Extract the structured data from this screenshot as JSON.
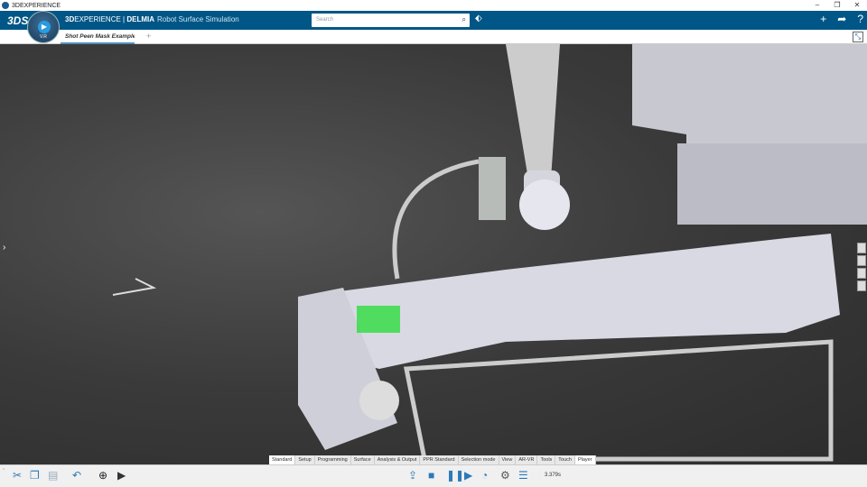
{
  "window": {
    "title": "3DEXPERIENCE",
    "controls": [
      "–",
      "❐",
      "✕"
    ]
  },
  "header": {
    "brand": "3DEXPERIENCE",
    "brand_bold": "3D",
    "brand_rest": "EXPERIENCE",
    "separator": " | ",
    "app": "DELMIA",
    "app_sub": "Robot Surface Simulation",
    "compass_version": "V.R",
    "search_placeholder": "Search"
  },
  "tabs": [
    {
      "label": "Shot Peen Mask Example A"
    }
  ],
  "toolbar_tabs": [
    "Standard",
    "Setup",
    "Programming",
    "Surface",
    "Analysis & Output",
    "PPR Standard",
    "Selection mode",
    "View",
    "AR-VR",
    "Tools",
    "Touch",
    "Player"
  ],
  "active_toolbar_tab": "Player",
  "player": {
    "time": "3.379s"
  },
  "icons": [
    "cut-icon",
    "copy-icon",
    "paste-icon",
    "undo-icon",
    "zoom-fit-icon",
    "publish-icon",
    "export-icon",
    "stop-icon",
    "pause-icon",
    "play-icon",
    "speed-icon",
    "settings-icon",
    "list-icon"
  ],
  "colors": {
    "brand": "#005686",
    "accent": "#2a7ab8"
  }
}
